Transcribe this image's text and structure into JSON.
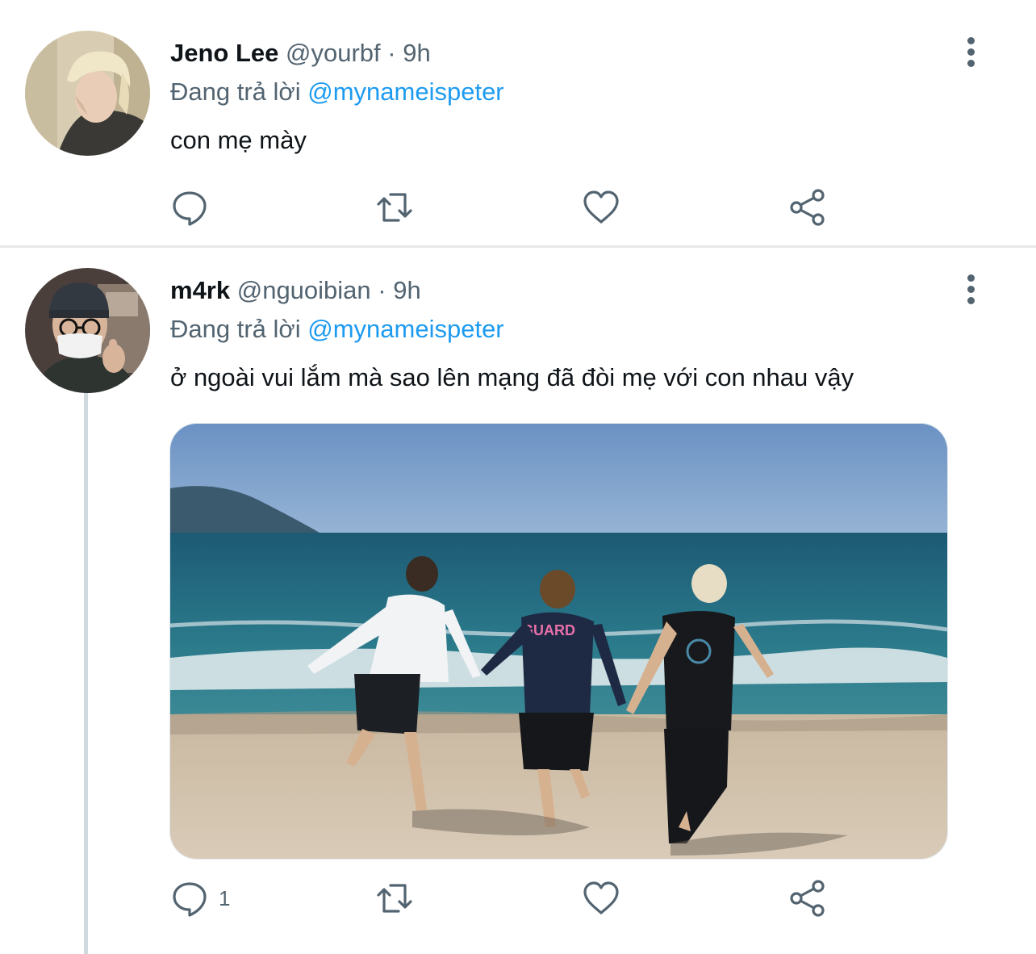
{
  "tweets": [
    {
      "display_name": "Jeno Lee",
      "handle": "@yourbf",
      "separator": "·",
      "time": "9h",
      "replying_label": "Đang trả lời",
      "replying_to": "@mynameispeter",
      "text": "con mẹ mày",
      "reply_count": "",
      "avatar_icon": "blond-hair-person-avatar"
    },
    {
      "display_name": "m4rk",
      "handle": "@nguoibian",
      "separator": "·",
      "time": "9h",
      "replying_label": "Đang trả lời",
      "replying_to": "@mynameispeter",
      "text": "ở ngoài vui lắm mà sao lên mạng đã đòi mẹ với con nhau vậy",
      "reply_count": "1",
      "avatar_icon": "beanie-glasses-mask-person-avatar",
      "media": {
        "description_icon": "beach-photo",
        "shirt_text": "GUARD"
      }
    }
  ],
  "icons": {
    "reply": "speech-bubble-icon",
    "retweet": "retweet-arrows-icon",
    "like": "heart-icon",
    "share": "share-nodes-icon",
    "more": "vertical-ellipsis-icon"
  },
  "colors": {
    "mention": "#1d9bf0",
    "secondary_text": "#536471",
    "primary_text": "#0f1419",
    "divider": "#e7e9eb",
    "thread_line": "#cfd9de"
  }
}
